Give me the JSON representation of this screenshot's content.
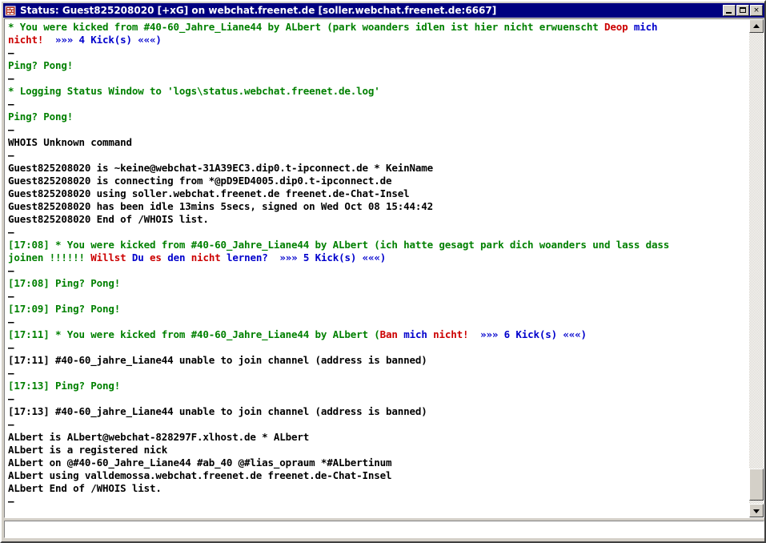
{
  "window": {
    "title": "Status: Guest825208020 [+xG] on webchat.freenet.de [soller.webchat.freenet.de:6667]",
    "icon": "mirc-status-window-icon",
    "buttons": {
      "minimize": "–",
      "maximize": "□",
      "close": "×"
    },
    "colors": {
      "titlebar": "#000080",
      "frame": "#d4d0c8",
      "chat_background": "#ffffff",
      "green": "#008000",
      "red": "#cc0000",
      "blue": "#0000cc",
      "black": "#000000"
    }
  },
  "scrollbar": {
    "up_arrow": "scroll-up-arrow",
    "down_arrow": "scroll-down-arrow",
    "thumb_position": "near-bottom"
  },
  "input": {
    "value": "",
    "placeholder": ""
  },
  "chat": {
    "lines": [
      [
        {
          "t": "* You were kicked from #40-60_Jahre_Liane44 by ALbert (park woanders idlen ist hier nicht erwuenscht ",
          "c": "green"
        },
        {
          "t": "Deop ",
          "c": "red"
        },
        {
          "t": "mich",
          "c": "blue"
        }
      ],
      [
        {
          "t": "nicht!",
          "c": "red"
        },
        {
          "t": "  ",
          "c": "black"
        },
        {
          "t": "»»» 4 Kick(s) «««)",
          "c": "blue"
        }
      ],
      [
        {
          "t": "–",
          "c": "black"
        }
      ],
      [
        {
          "t": "Ping? Pong!",
          "c": "green"
        }
      ],
      [
        {
          "t": "–",
          "c": "black"
        }
      ],
      [
        {
          "t": "* Logging Status Window to 'logs\\status.webchat.freenet.de.log'",
          "c": "green"
        }
      ],
      [
        {
          "t": "–",
          "c": "black"
        }
      ],
      [
        {
          "t": "Ping? Pong!",
          "c": "green"
        }
      ],
      [
        {
          "t": "–",
          "c": "black"
        }
      ],
      [
        {
          "t": "WHOIS Unknown command",
          "c": "black"
        }
      ],
      [
        {
          "t": "–",
          "c": "black"
        }
      ],
      [
        {
          "t": "Guest825208020 is ~keine@webchat-31A39EC3.dip0.t-ipconnect.de * KeinName",
          "c": "black"
        }
      ],
      [
        {
          "t": "Guest825208020 is connecting from *@pD9ED4005.dip0.t-ipconnect.de",
          "c": "black"
        }
      ],
      [
        {
          "t": "Guest825208020 using soller.webchat.freenet.de freenet.de-Chat-Insel",
          "c": "black"
        }
      ],
      [
        {
          "t": "Guest825208020 has been idle 13mins 5secs, signed on Wed Oct 08 15:44:42",
          "c": "black"
        }
      ],
      [
        {
          "t": "Guest825208020 End of /WHOIS list.",
          "c": "black"
        }
      ],
      [
        {
          "t": "–",
          "c": "black"
        }
      ],
      [
        {
          "t": "[17:08] * You were kicked from #40-60_Jahre_Liane44 by ALbert (ich hatte gesagt park dich woanders und lass dass",
          "c": "green"
        }
      ],
      [
        {
          "t": "joinen !!!!!! ",
          "c": "green"
        },
        {
          "t": "Willst ",
          "c": "red"
        },
        {
          "t": "Du ",
          "c": "blue"
        },
        {
          "t": "es ",
          "c": "red"
        },
        {
          "t": "den ",
          "c": "blue"
        },
        {
          "t": "nicht ",
          "c": "red"
        },
        {
          "t": "lernen?",
          "c": "blue"
        },
        {
          "t": "  ",
          "c": "black"
        },
        {
          "t": "»»» 5 Kick(s) «««)",
          "c": "blue"
        }
      ],
      [
        {
          "t": "–",
          "c": "black"
        }
      ],
      [
        {
          "t": "[17:08] Ping? Pong!",
          "c": "green"
        }
      ],
      [
        {
          "t": "–",
          "c": "black"
        }
      ],
      [
        {
          "t": "[17:09] Ping? Pong!",
          "c": "green"
        }
      ],
      [
        {
          "t": "–",
          "c": "black"
        }
      ],
      [
        {
          "t": "[17:11] * You were kicked from #40-60_Jahre_Liane44 by ALbert (",
          "c": "green"
        },
        {
          "t": "Ban ",
          "c": "red"
        },
        {
          "t": "mich ",
          "c": "blue"
        },
        {
          "t": "nicht!",
          "c": "red"
        },
        {
          "t": "  ",
          "c": "black"
        },
        {
          "t": "»»» 6 Kick(s) «««)",
          "c": "blue"
        }
      ],
      [
        {
          "t": "–",
          "c": "black"
        }
      ],
      [
        {
          "t": "[17:11] #40-60_jahre_Liane44 unable to join channel (address is banned)",
          "c": "black"
        }
      ],
      [
        {
          "t": "–",
          "c": "black"
        }
      ],
      [
        {
          "t": "[17:13] Ping? Pong!",
          "c": "green"
        }
      ],
      [
        {
          "t": "–",
          "c": "black"
        }
      ],
      [
        {
          "t": "[17:13] #40-60_jahre_Liane44 unable to join channel (address is banned)",
          "c": "black"
        }
      ],
      [
        {
          "t": "–",
          "c": "black"
        }
      ],
      [
        {
          "t": "ALbert is ALbert@webchat-828297F.xlhost.de * ALbert",
          "c": "black"
        }
      ],
      [
        {
          "t": "ALbert is a registered nick",
          "c": "black"
        }
      ],
      [
        {
          "t": "ALbert on @#40-60_Jahre_Liane44 #ab_40 @#lias_opraum *#ALbertinum",
          "c": "black"
        }
      ],
      [
        {
          "t": "ALbert using valldemossa.webchat.freenet.de freenet.de-Chat-Insel",
          "c": "black"
        }
      ],
      [
        {
          "t": "ALbert End of /WHOIS list.",
          "c": "black"
        }
      ],
      [
        {
          "t": "–",
          "c": "black"
        }
      ]
    ]
  }
}
